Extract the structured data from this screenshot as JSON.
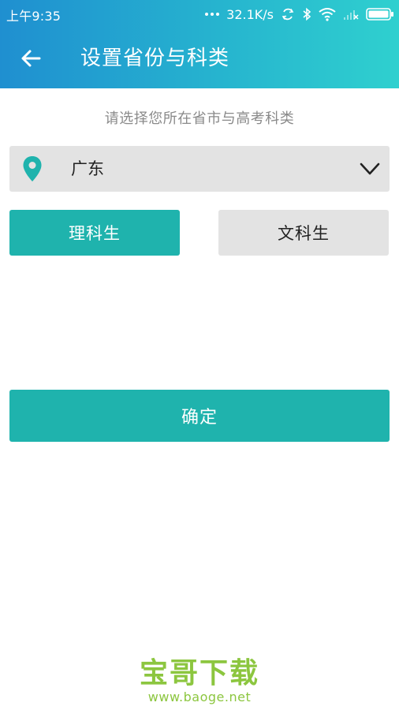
{
  "status_bar": {
    "time": "上午9:35",
    "network_speed": "32.1K/s",
    "battery_level": 1.0
  },
  "nav": {
    "title": "设置省份与科类",
    "back_icon": "arrow-left-icon"
  },
  "form": {
    "prompt": "请选择您所在省市与高考科类",
    "province": {
      "selected": "广东",
      "icon": "location-pin-icon",
      "dropdown_icon": "chevron-down-icon"
    },
    "subjects": [
      {
        "label": "理科生",
        "selected": true
      },
      {
        "label": "文科生",
        "selected": false
      }
    ],
    "confirm_label": "确定"
  },
  "watermark": {
    "title": "宝哥下载",
    "url": "www.baoge.net"
  },
  "colors": {
    "header_gradient_start": "#1f8fd0",
    "header_gradient_end": "#2fd0cf",
    "accent": "#1fb3ad",
    "inactive_bg": "#e3e3e3",
    "watermark": "#8cc63f"
  }
}
